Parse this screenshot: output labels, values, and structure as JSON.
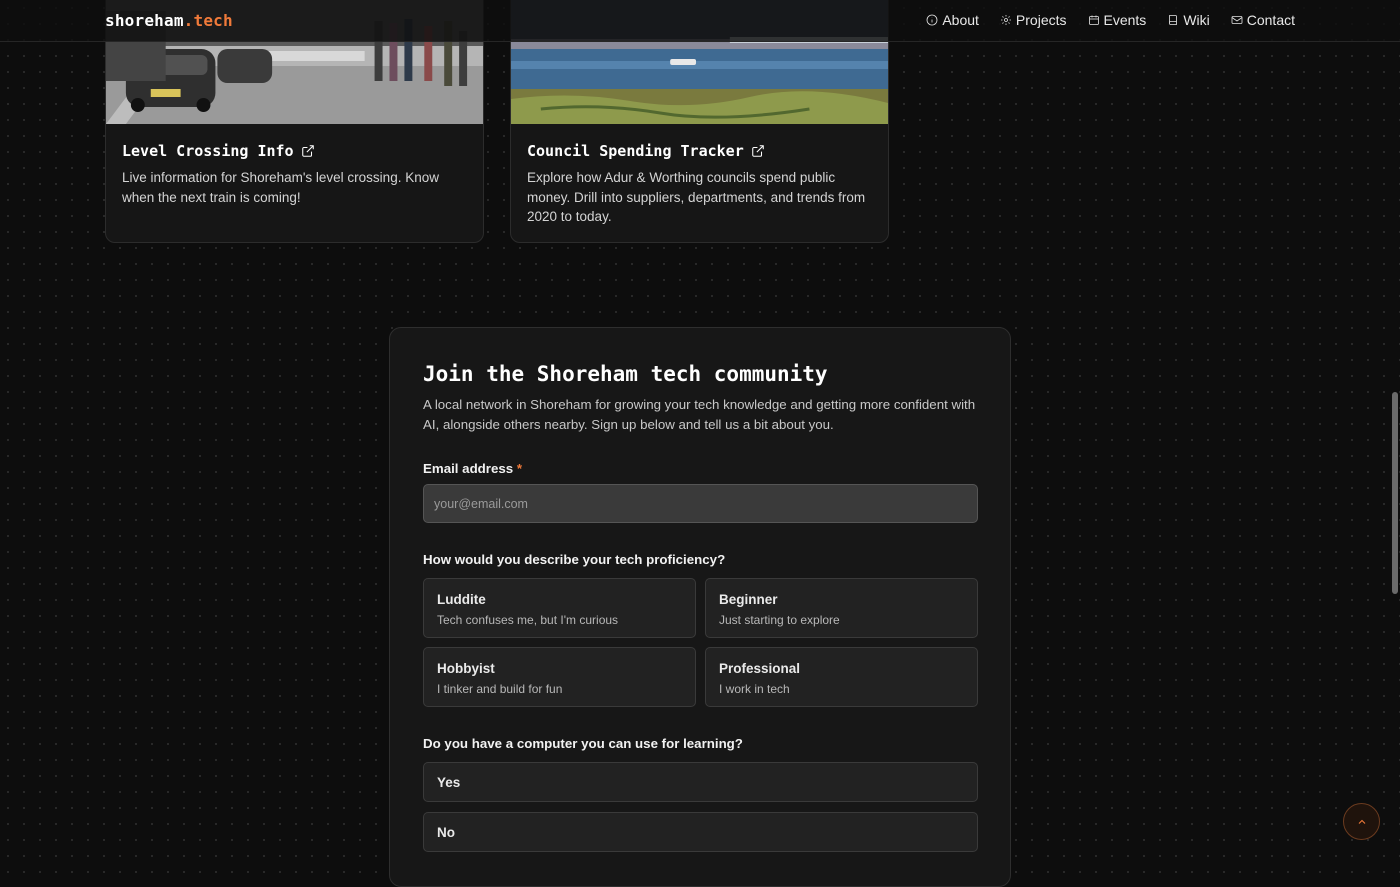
{
  "brand": {
    "name": "shoreham",
    "accent": ".tech"
  },
  "nav": {
    "items": [
      {
        "label": "About",
        "icon": "info-icon"
      },
      {
        "label": "Projects",
        "icon": "gear-icon"
      },
      {
        "label": "Events",
        "icon": "calendar-icon"
      },
      {
        "label": "Wiki",
        "icon": "book-icon"
      },
      {
        "label": "Contact",
        "icon": "mail-icon"
      }
    ]
  },
  "projects": [
    {
      "title": "Level Crossing Info",
      "description": "Live information for Shoreham's level crossing. Know when the next train is coming!",
      "icon": "external-link-icon"
    },
    {
      "title": "Council Spending Tracker",
      "description": "Explore how Adur & Worthing councils spend public money. Drill into suppliers, departments, and trends from 2020 to today.",
      "icon": "external-link-icon"
    }
  ],
  "join": {
    "title": "Join the Shoreham tech community",
    "subtitle": "A local network in Shoreham for growing your tech knowledge and getting more confident with AI, alongside others nearby. Sign up below and tell us a bit about you.",
    "email_label": "Email address",
    "email_required": "*",
    "email_placeholder": "your@email.com",
    "email_value": "",
    "proficiency_question": "How would you describe your tech proficiency?",
    "proficiency_options": [
      {
        "title": "Luddite",
        "desc": "Tech confuses me, but I'm curious"
      },
      {
        "title": "Beginner",
        "desc": "Just starting to explore"
      },
      {
        "title": "Hobbyist",
        "desc": "I tinker and build for fun"
      },
      {
        "title": "Professional",
        "desc": "I work in tech"
      }
    ],
    "computer_question": "Do you have a computer you can use for learning?",
    "computer_options": [
      "Yes",
      "No"
    ]
  },
  "colors": {
    "accent": "#f07a3a",
    "background": "#0d0d0d",
    "card": "#161616",
    "panel": "#171717"
  },
  "back_to_top_icon": "chevron-up-icon"
}
